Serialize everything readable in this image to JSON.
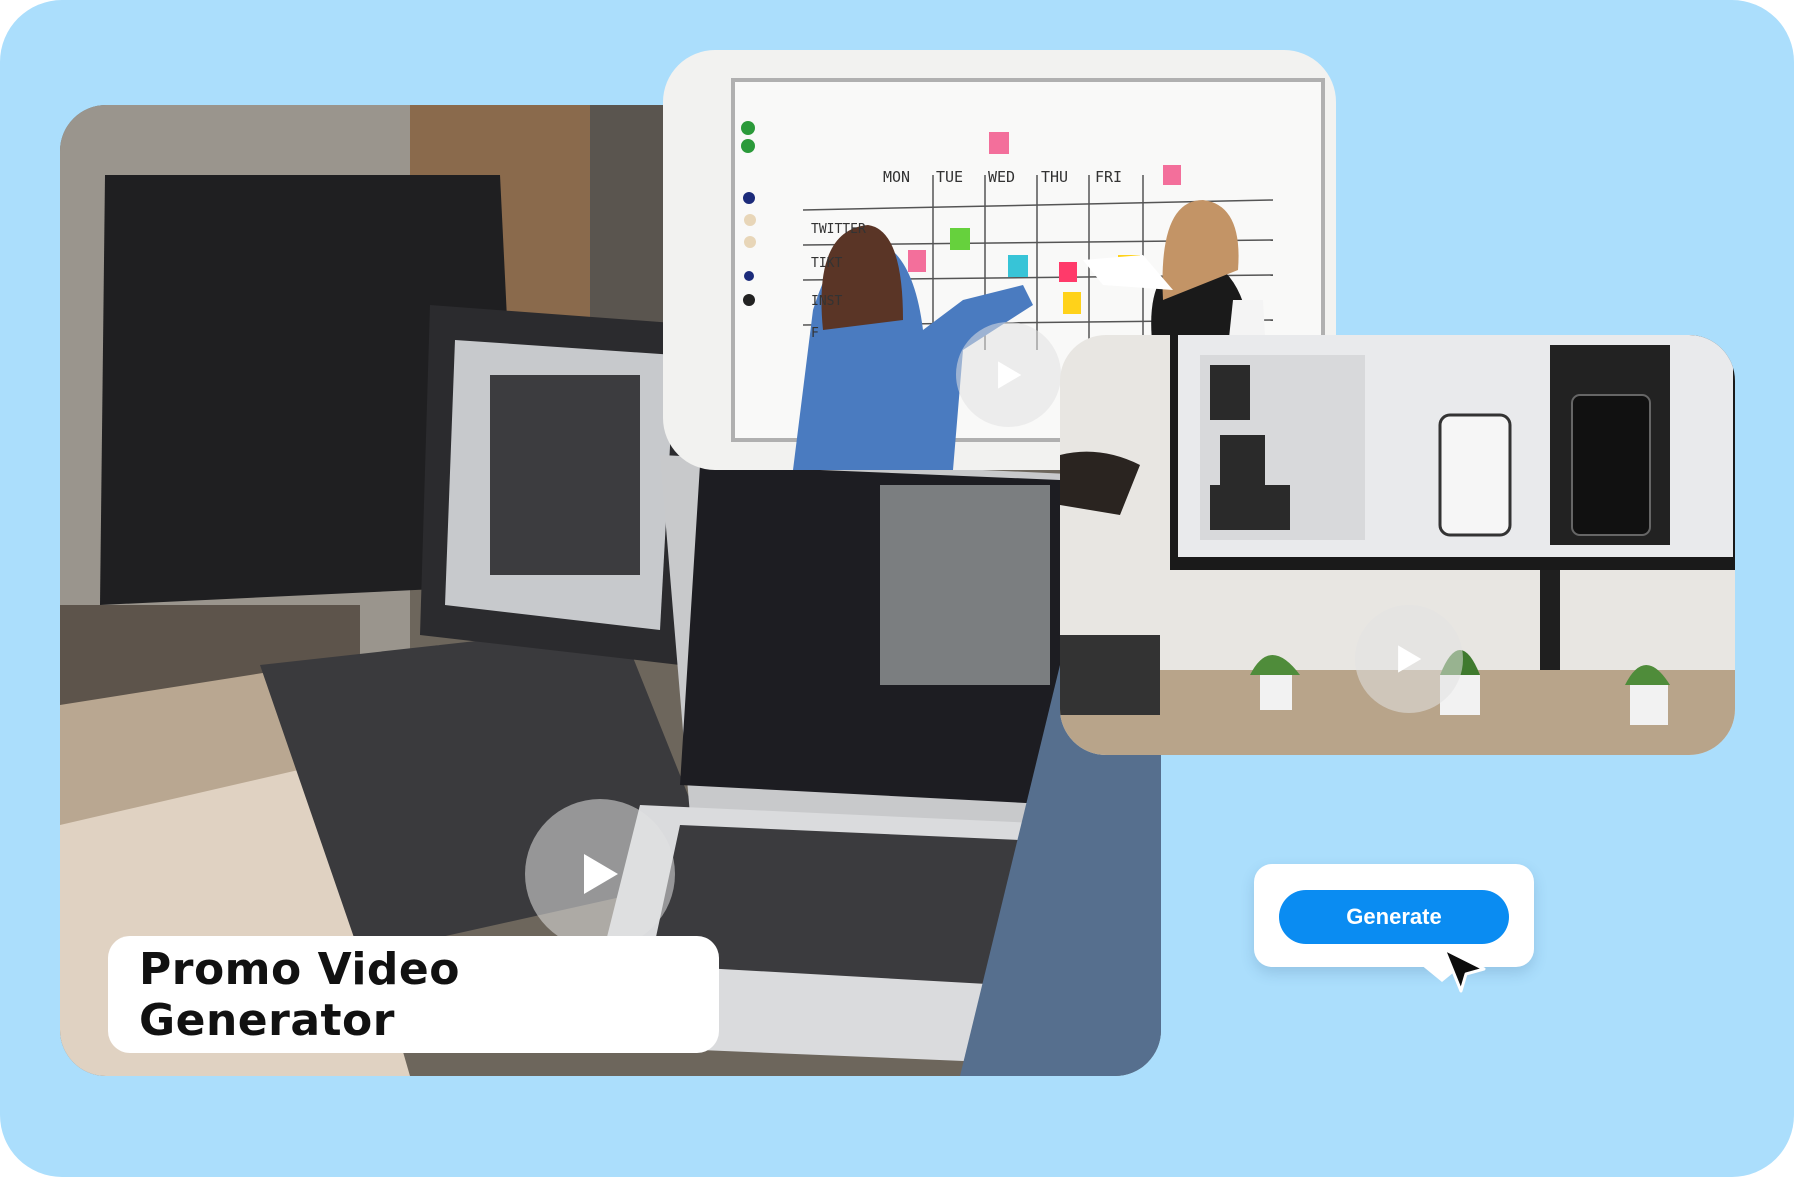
{
  "title": "Promo Video Generator",
  "generate_label": "Generate",
  "whiteboard": {
    "days": [
      "MON",
      "TUE",
      "WED",
      "THU",
      "FRI"
    ],
    "rows": [
      "TWITTER",
      "TIKT",
      "INST",
      "F"
    ]
  },
  "colors": {
    "background": "#abdefc",
    "button": "#0a8cf2",
    "button_text": "#ffffff",
    "title_text": "#111111"
  },
  "icons": {
    "play": "play-icon",
    "cursor": "mouse-pointer-icon"
  }
}
